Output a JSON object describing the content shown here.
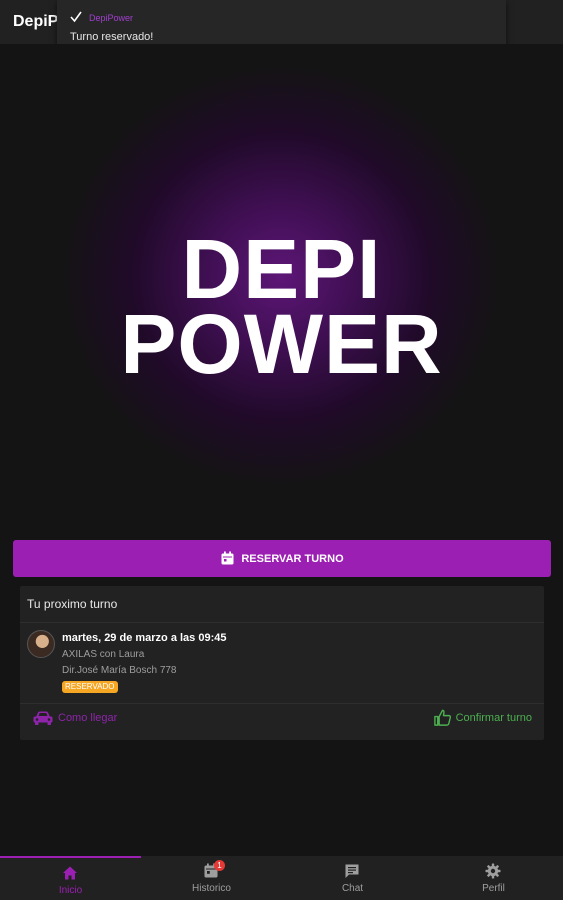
{
  "app": {
    "title": "DepiPower"
  },
  "toast": {
    "app_name": "DepiPower",
    "message": "Turno reservado!"
  },
  "logo": {
    "line1": "DEPI",
    "line2": "POWER"
  },
  "reserve_button": {
    "label": "RESERVAR TURNO"
  },
  "next_appointment": {
    "title": "Tu proximo turno",
    "date": "martes, 29 de marzo a las 09:45",
    "service": "AXILAS con Laura",
    "address": "Dir.José María Bosch 778",
    "status": "RESERVADO",
    "actions": {
      "directions": "Como llegar",
      "confirm": "Confirmar turno"
    }
  },
  "bottom_nav": {
    "items": [
      {
        "label": "Inicio",
        "icon": "home-icon",
        "active": true
      },
      {
        "label": "Historico",
        "icon": "calendar-icon",
        "badge": "1"
      },
      {
        "label": "Chat",
        "icon": "chat-icon"
      },
      {
        "label": "Perfil",
        "icon": "gear-icon"
      }
    ]
  },
  "colors": {
    "accent": "#9c1fb3",
    "confirm": "#4caf50",
    "status_badge": "#f5a623",
    "background": "#141414",
    "nav_badge": "#e53935"
  }
}
